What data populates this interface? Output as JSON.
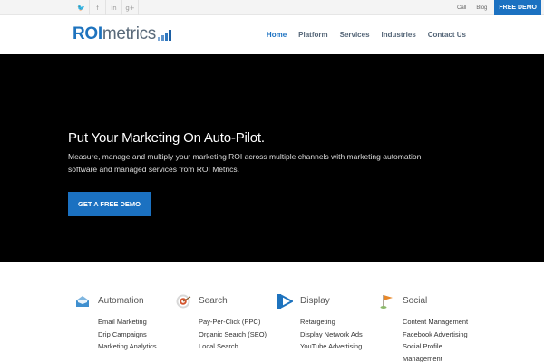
{
  "topbar": {
    "social": [
      {
        "name": "twitter",
        "glyph": "🐦"
      },
      {
        "name": "facebook",
        "glyph": "f"
      },
      {
        "name": "linkedin",
        "glyph": "in"
      },
      {
        "name": "google-plus",
        "glyph": "g+"
      }
    ],
    "links": [
      "Call",
      "Blog"
    ],
    "cta_label": "FREE DEMO",
    "cta_color": "#1b71c1"
  },
  "header": {
    "logo_roi": "ROI",
    "logo_metrics": "metrics",
    "nav": [
      {
        "label": "Home",
        "active": true
      },
      {
        "label": "Platform",
        "active": false
      },
      {
        "label": "Services",
        "active": false
      },
      {
        "label": "Industries",
        "active": false
      },
      {
        "label": "Contact Us",
        "active": false
      }
    ]
  },
  "hero": {
    "title": "Put Your Marketing On Auto-Pilot.",
    "subtitle": "Measure, manage and multiply your marketing ROI across multiple channels with marketing automation software and managed services from ROI Metrics.",
    "cta_label": "GET A FREE DEMO"
  },
  "features": [
    {
      "id": "automation",
      "icon": "envelope-tray-icon",
      "title": "Automation",
      "items": [
        "Email Marketing",
        "Drip Campaigns",
        "Marketing Analytics"
      ]
    },
    {
      "id": "search",
      "icon": "target-icon",
      "title": "Search",
      "items": [
        "Pay-Per-Click (PPC)",
        "Organic Search (SEO)",
        "Local Search"
      ]
    },
    {
      "id": "display",
      "icon": "play-display-icon",
      "title": "Display",
      "items": [
        "Retargeting",
        "Display Network Ads",
        "YouTube Advertising"
      ]
    },
    {
      "id": "social",
      "icon": "flag-icon",
      "title": "Social",
      "items": [
        "Content Management",
        "Facebook Advertising",
        "Social Profile",
        "Management"
      ]
    }
  ]
}
